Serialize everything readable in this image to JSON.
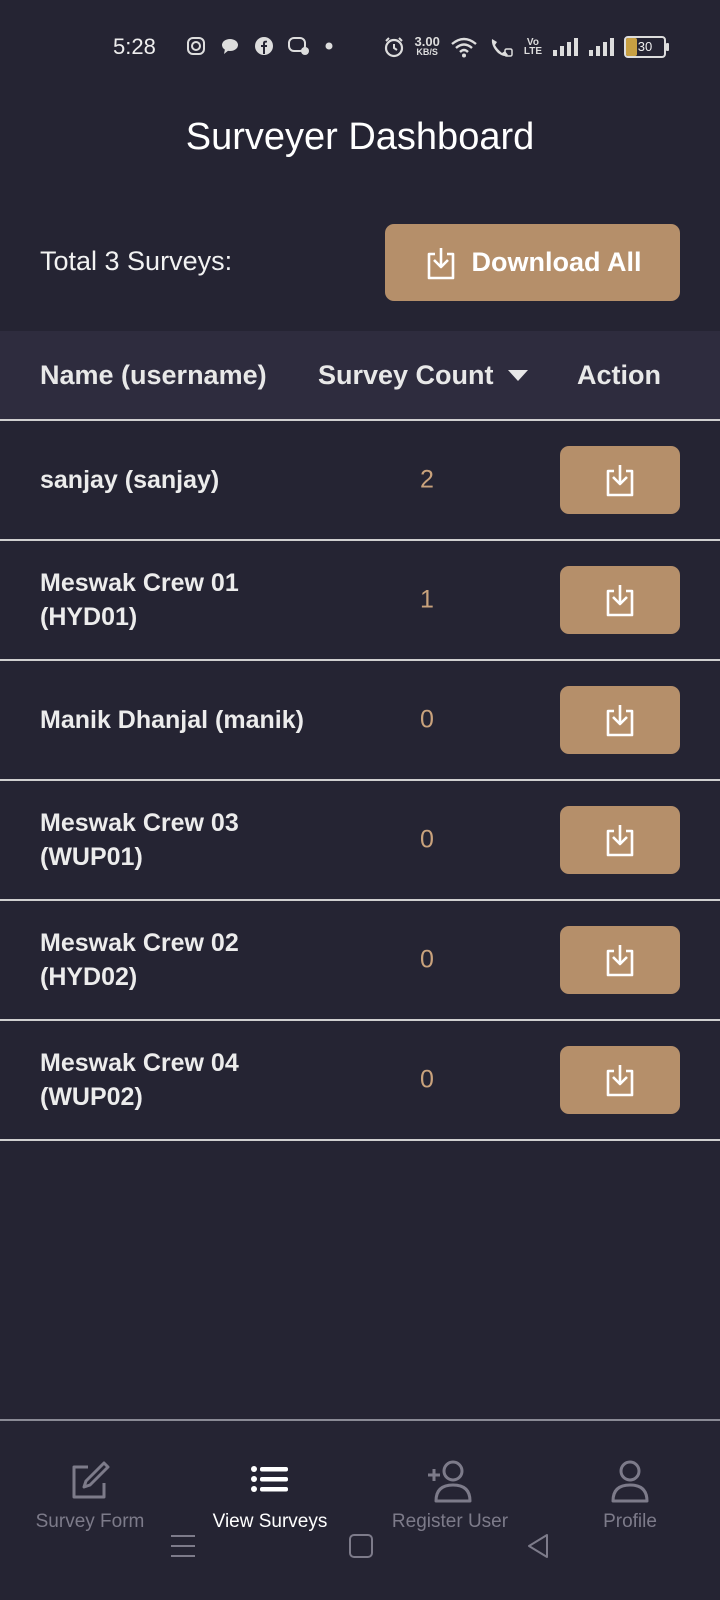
{
  "status_bar": {
    "time": "5:28",
    "speed": "3.00",
    "speed_unit": "KB/S",
    "battery": "30",
    "icons": [
      "instagram-icon",
      "chat-bubble-icon",
      "facebook-icon",
      "messenger-icon",
      "dot-icon",
      "alarm-icon",
      "wifi-icon",
      "wifi-call-icon",
      "volte-icon",
      "signal-icon",
      "signal-icon",
      "battery-icon"
    ]
  },
  "header": {
    "title": "Surveyer Dashboard"
  },
  "summary": {
    "total_text": "Total 3 Surveys:",
    "download_all_label": "Download All"
  },
  "table": {
    "columns": [
      "Name (username)",
      "Survey Count",
      "Action"
    ],
    "sort_column": "Survey Count",
    "sort_direction": "descending",
    "rows": [
      {
        "name": "sanjay (sanjay)",
        "count": "2"
      },
      {
        "name": "Meswak Crew 01 (HYD01)",
        "count": "1"
      },
      {
        "name": "Manik Dhanjal (manik)",
        "count": "0"
      },
      {
        "name": "Meswak Crew 03 (WUP01)",
        "count": "0"
      },
      {
        "name": "Meswak Crew 02 (HYD02)",
        "count": "0"
      },
      {
        "name": "Meswak Crew 04 (WUP02)",
        "count": "0"
      }
    ]
  },
  "bottom_nav": {
    "items": [
      {
        "label": "Survey Form",
        "icon": "edit-form-icon"
      },
      {
        "label": "View Surveys",
        "icon": "list-icon",
        "active": true
      },
      {
        "label": "Register User",
        "icon": "add-user-icon"
      },
      {
        "label": "Profile",
        "icon": "profile-icon"
      }
    ]
  },
  "colors": {
    "background": "#252433",
    "accent": "#b58f6a",
    "count_text": "#c9a27c",
    "inactive_nav": "#7d7b8a"
  }
}
